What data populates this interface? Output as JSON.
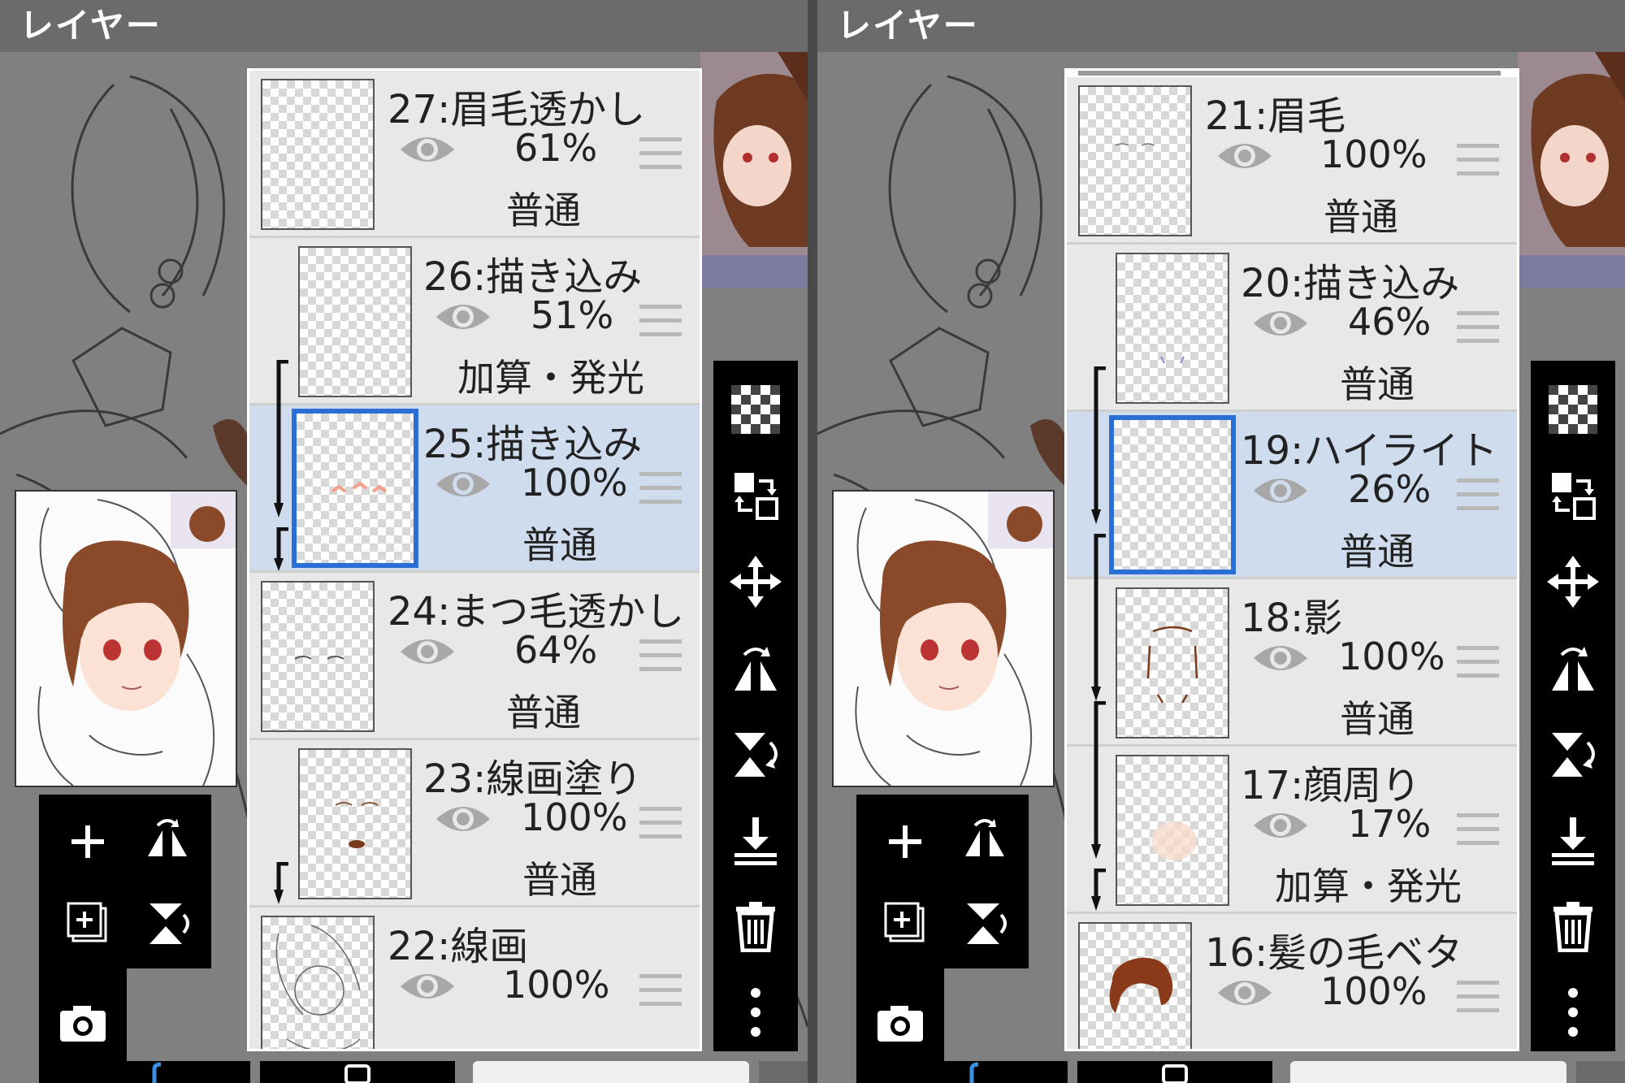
{
  "left": {
    "title": "レイヤー",
    "layers": [
      {
        "name": "27:眉毛透かし",
        "opacity": "61%",
        "blend": "普通",
        "selected": false,
        "clipped": false
      },
      {
        "name": "26:描き込み",
        "opacity": "51%",
        "blend": "加算・発光",
        "selected": false,
        "clipped": true
      },
      {
        "name": "25:描き込み",
        "opacity": "100%",
        "blend": "普通",
        "selected": true,
        "clipped": true
      },
      {
        "name": "24:まつ毛透かし",
        "opacity": "64%",
        "blend": "普通",
        "selected": false,
        "clipped": false
      },
      {
        "name": "23:線画塗り",
        "opacity": "100%",
        "blend": "普通",
        "selected": false,
        "clipped": true
      },
      {
        "name": "22:線画",
        "opacity": "100%",
        "blend": "",
        "selected": false,
        "clipped": false
      }
    ]
  },
  "right": {
    "title": "レイヤー",
    "layers": [
      {
        "name": "21:眉毛",
        "opacity": "100%",
        "blend": "普通",
        "selected": false,
        "clipped": false
      },
      {
        "name": "20:描き込み",
        "opacity": "46%",
        "blend": "普通",
        "selected": false,
        "clipped": true
      },
      {
        "name": "19:ハイライト",
        "opacity": "26%",
        "blend": "普通",
        "selected": true,
        "clipped": true
      },
      {
        "name": "18:影",
        "opacity": "100%",
        "blend": "普通",
        "selected": false,
        "clipped": true
      },
      {
        "name": "17:顔周り",
        "opacity": "17%",
        "blend": "加算・発光",
        "selected": false,
        "clipped": true
      },
      {
        "name": "16:髪の毛ベタ",
        "opacity": "100%",
        "blend": "",
        "selected": false,
        "clipped": false
      }
    ]
  },
  "sidebar_icons": [
    "transparency-icon",
    "swap-layers-icon",
    "move-icon",
    "flip-horizontal-icon",
    "flip-vertical-icon",
    "merge-down-icon",
    "trash-icon",
    "more-icon"
  ],
  "toolbox_icons": [
    "add-layer-icon",
    "flip-h-icon",
    "duplicate-layer-icon",
    "flip-v-icon",
    "camera-icon"
  ],
  "colors": {
    "selected_row": "#cfdcee",
    "selected_border": "#2a6fd6",
    "row_bg": "#e8e8e8"
  }
}
